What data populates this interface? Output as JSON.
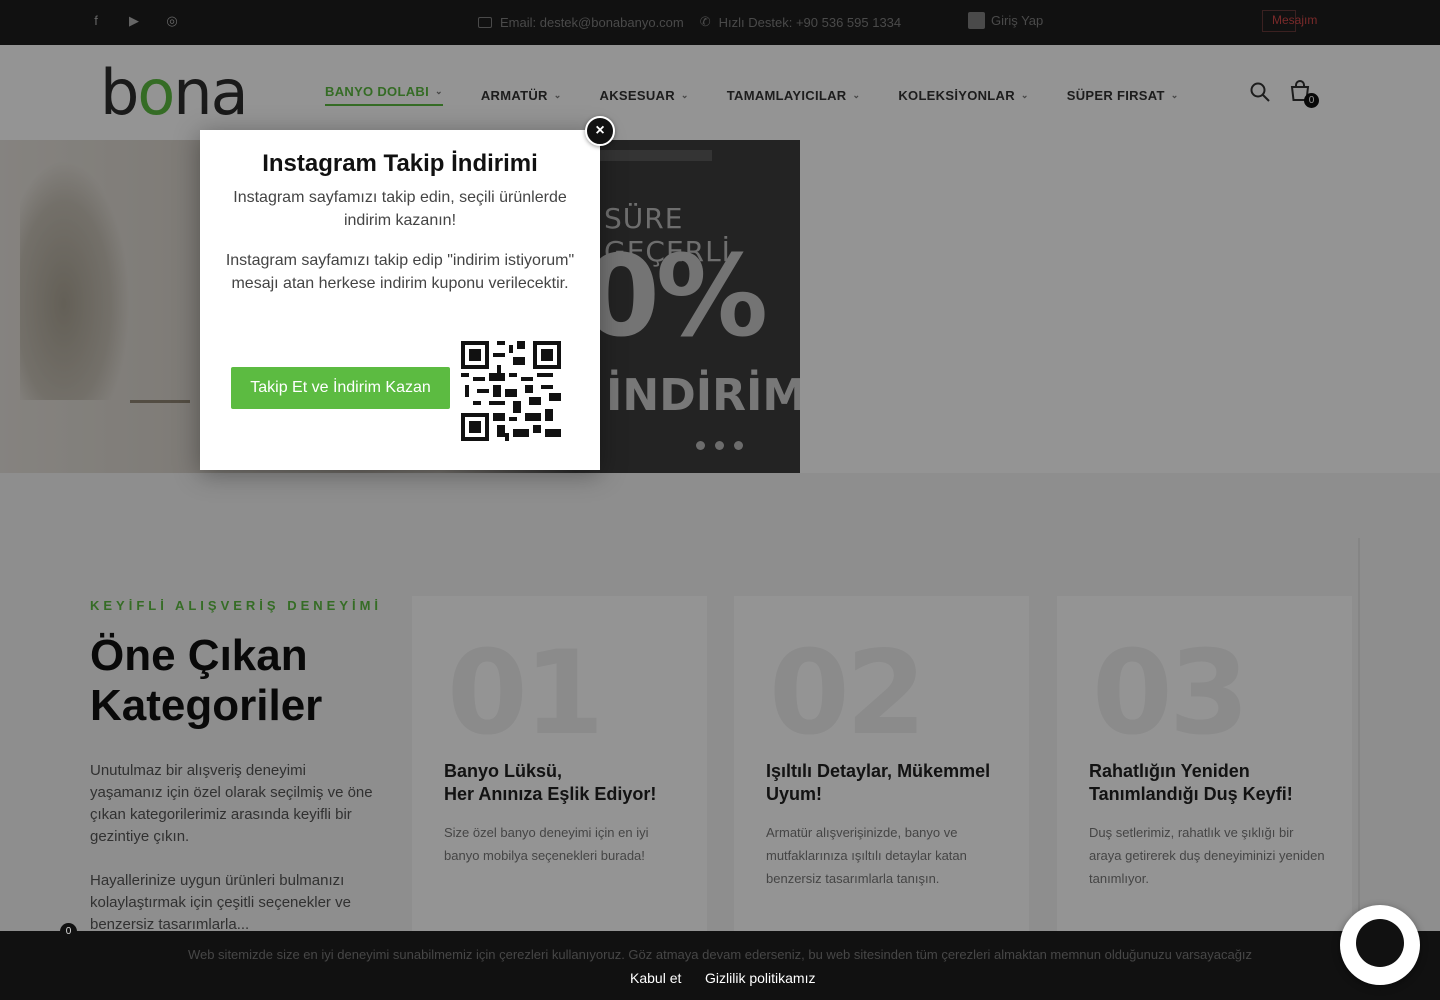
{
  "topbar": {
    "social_icons": [
      "facebook-icon",
      "youtube-icon",
      "instagram-icon"
    ],
    "email": "Email: destek@bonabanyo.com",
    "phone": "Hızlı Destek: +90 536 595 1334",
    "login": "Giriş Yap",
    "message": "Mesajım"
  },
  "header": {
    "logo_text_a": "b",
    "logo_text_b": "o",
    "logo_text_c": "na",
    "nav": [
      {
        "label": "BANYO DOLABI",
        "active": true
      },
      {
        "label": "ARMATÜR"
      },
      {
        "label": "AKSESUAR"
      },
      {
        "label": "TAMAMLAYICILAR"
      },
      {
        "label": "KOLEKSİYONLAR"
      },
      {
        "label": "SÜPER FIRSAT"
      }
    ],
    "cart_count": "0"
  },
  "hero": {
    "promo_line1": "SÜRE GEÇERLİ",
    "promo_pct": "0%",
    "promo_line3": "İNDİRİM"
  },
  "modal": {
    "title": "Instagram Takip İndirimi",
    "subtitle": "Instagram sayfamızı takip edin, seçili ürünlerde indirim kazanın!",
    "body": "Instagram sayfamızı takip edip \"indirim istiyorum\" mesajı atan herkese indirim kuponu verilecektir.",
    "cta": "Takip Et ve İndirim Kazan",
    "close": "×"
  },
  "section": {
    "kicker": "KEYİFLİ ALIŞVERİŞ DENEYİMİ",
    "title": "Öne Çıkan Kategoriler",
    "p1": "Unutulmaz bir alışveriş deneyimi yaşamanız için özel olarak seçilmiş ve öne çıkan kategorilerimiz arasında keyifli bir gezintiye çıkın.",
    "p2": "Hayallerinize uygun ürünleri bulmanızı kolaylaştırmak için çeşitli seçenekler ve benzersiz tasarımlarla...",
    "cards": [
      {
        "num": "01",
        "title": "Banyo Lüksü,\nHer Anınıza Eşlik Ediyor!",
        "desc": "Size özel banyo deneyimi için en iyi banyo mobilya seçenekleri burada!"
      },
      {
        "num": "02",
        "title": "Işıltılı Detaylar, Mükemmel Uyum!",
        "desc": "Armatür alışverişinizde, banyo ve mutfaklarınıza ışıltılı detaylar katan benzersiz tasarımlarla tanışın."
      },
      {
        "num": "03",
        "title": "Rahatlığın Yeniden Tanımlandığı Duş Keyfi!",
        "desc": "Duş setlerimiz, rahatlık ve şıklığı bir araya getirerek duş deneyiminizi yeniden tanımlıyor."
      }
    ]
  },
  "cookie": {
    "text": "Web sitemizde size en iyi deneyimi sunabilmemiz için çerezleri kullanıyoruz. Göz atmaya devam ederseniz, bu web sitesinden tüm çerezleri almaktan memnun olduğunuzu varsayacağız",
    "accept": "Kabul et",
    "privacy": "Gizlilik politikamız",
    "count": "0"
  },
  "colors": {
    "accent": "#5cbb41",
    "dark": "#111111"
  }
}
